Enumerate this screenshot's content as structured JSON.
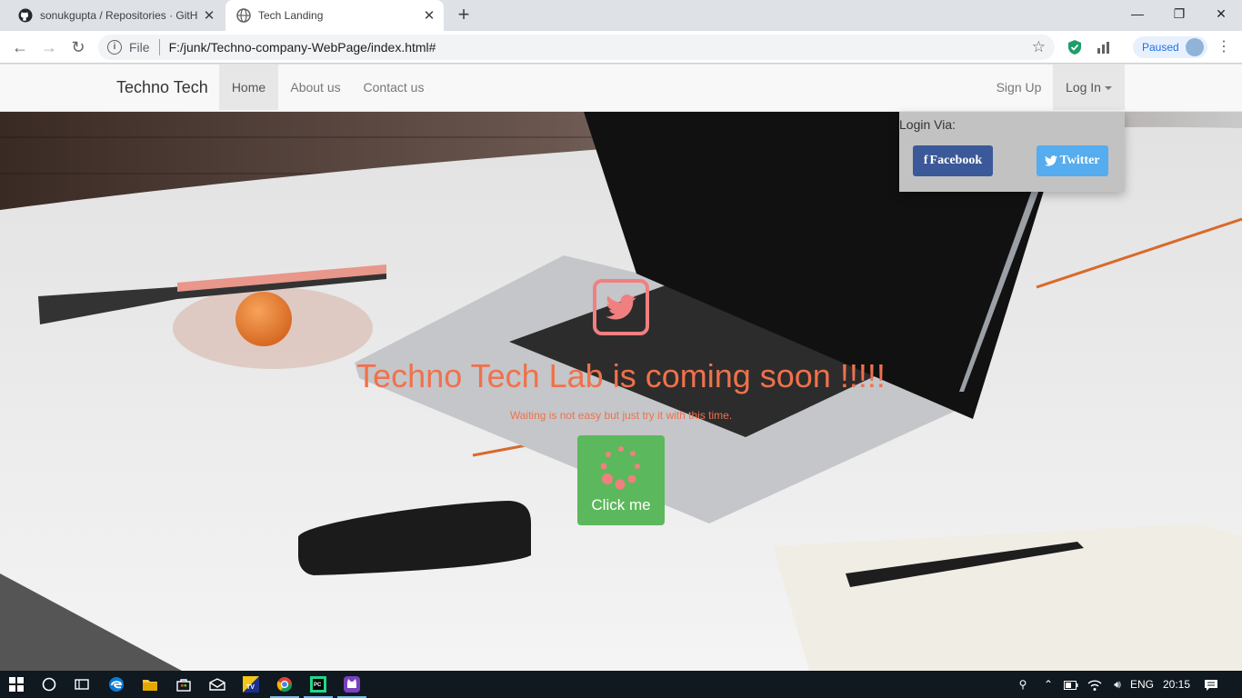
{
  "browser": {
    "tabs": [
      {
        "title": "sonukgupta / Repositories · GitH",
        "icon": "github-icon"
      },
      {
        "title": "Tech Landing",
        "icon": "globe-icon"
      }
    ],
    "scheme": "File",
    "url": "F:/junk/Techno-company-WebPage/index.html#",
    "profile_status": "Paused"
  },
  "navbar": {
    "brand": "Techno Tech",
    "items": [
      {
        "label": "Home",
        "active": true
      },
      {
        "label": "About us"
      },
      {
        "label": "Contact us"
      }
    ],
    "right": [
      {
        "label": "Sign Up"
      },
      {
        "label": "Log In"
      }
    ]
  },
  "dropdown": {
    "label": "Login Via:",
    "facebook": "Facebook",
    "twitter": "Twitter"
  },
  "hero": {
    "headline": "Techno Tech Lab is coming soon !!!!!",
    "subline": "Waiting is not easy but just try it with this time.",
    "button": "Click me"
  },
  "taskbar": {
    "language": "ENG",
    "time": "20:15"
  },
  "colors": {
    "accent_orange": "#f0714c",
    "button_green": "#5cb85c",
    "facebook_blue": "#3b5998",
    "twitter_blue": "#55acee",
    "bird_pink": "#f08080"
  }
}
